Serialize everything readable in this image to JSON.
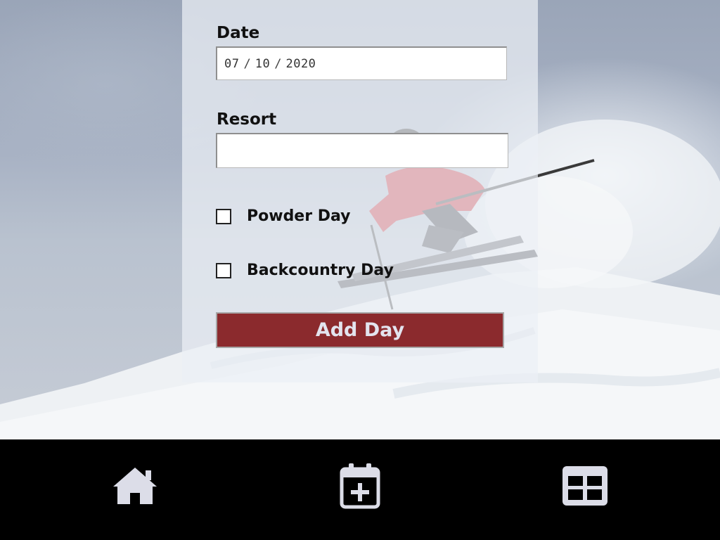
{
  "form": {
    "date": {
      "label": "Date",
      "month": "07",
      "day": "10",
      "year": "2020",
      "separator": "/"
    },
    "resort": {
      "label": "Resort",
      "value": ""
    },
    "powder_day": {
      "label": "Powder Day",
      "checked": false
    },
    "backcountry_day": {
      "label": "Backcountry Day",
      "checked": false
    },
    "submit_label": "Add Day"
  },
  "nav": {
    "items": [
      {
        "name": "home",
        "icon": "home-icon"
      },
      {
        "name": "add-day",
        "icon": "calendar-plus-icon"
      },
      {
        "name": "list",
        "icon": "table-icon"
      }
    ]
  },
  "colors": {
    "accent": "#8b2a2d",
    "button_text": "#e3e4ee",
    "nav_bg": "#000000",
    "nav_icon": "#dcdde8"
  }
}
